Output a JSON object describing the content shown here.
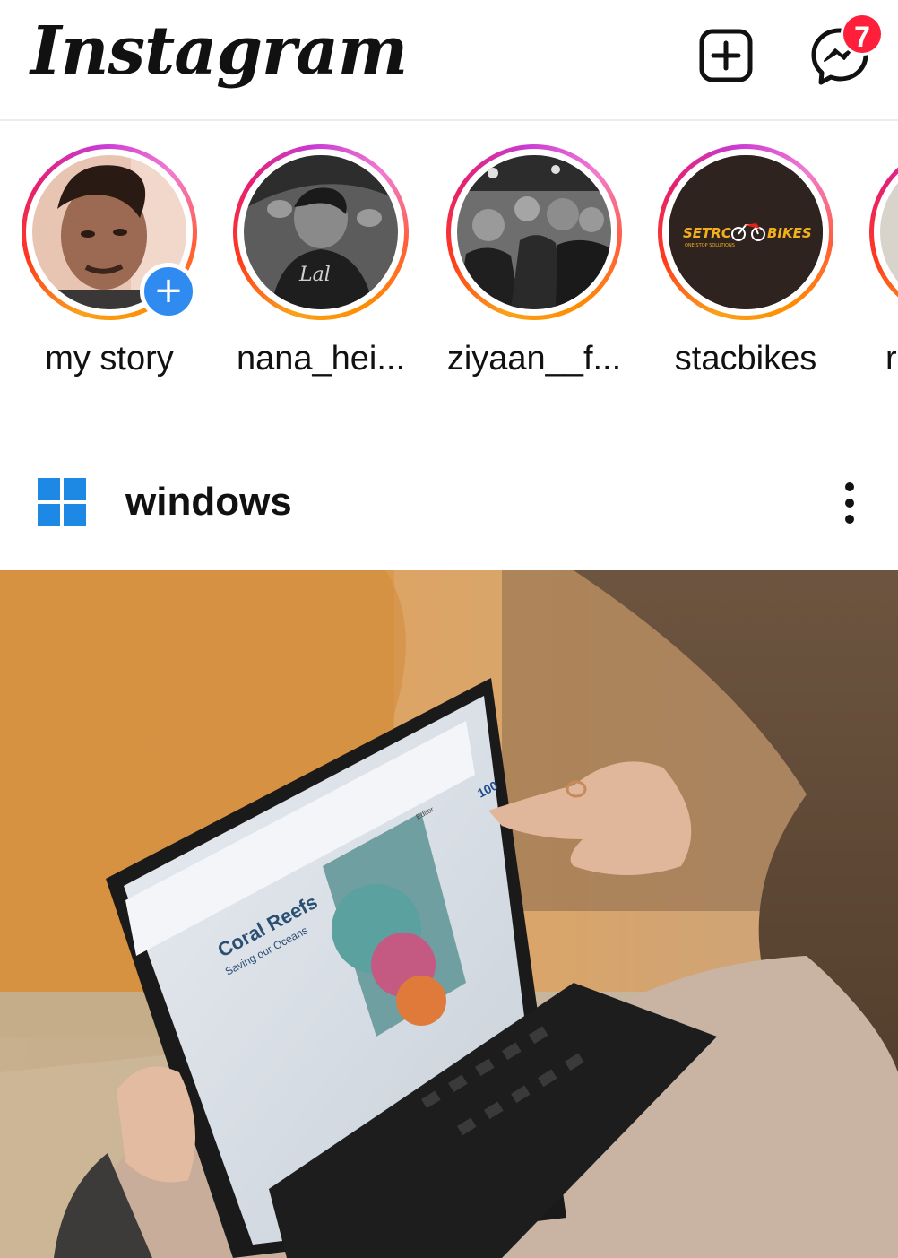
{
  "header": {
    "logo_text": "Instagram",
    "add_post_icon": "add-square-icon",
    "messenger_icon": "messenger-icon",
    "messenger_badge": "7",
    "badge_color": "#ff1f3a"
  },
  "stories": [
    {
      "label": "my story",
      "has_add_badge": true,
      "add_badge_text": "+"
    },
    {
      "label": "nana_hei..."
    },
    {
      "label": "ziyaan__f..."
    },
    {
      "label": "stacbikes",
      "logo_text_left": "SETRC",
      "logo_text_right": "BIKES",
      "logo_tagline": "ONE STOP SOLUTIONS"
    },
    {
      "label": "r"
    }
  ],
  "post": {
    "username": "windows",
    "avatar_icon": "windows-logo-icon",
    "more_icon": "more-options-icon",
    "image": {
      "doc_title": "Coral Reefs",
      "doc_subtitle": "Saving our Oceans",
      "zoom_label": "100",
      "editor_label": "Editor"
    }
  },
  "colors": {
    "story_ring": [
      "#f9a11a",
      "#ff3a1b",
      "#e6206f",
      "#c93bd4"
    ],
    "add_badge": "#2f8bf0",
    "windows_blue": "#1e88e5"
  }
}
